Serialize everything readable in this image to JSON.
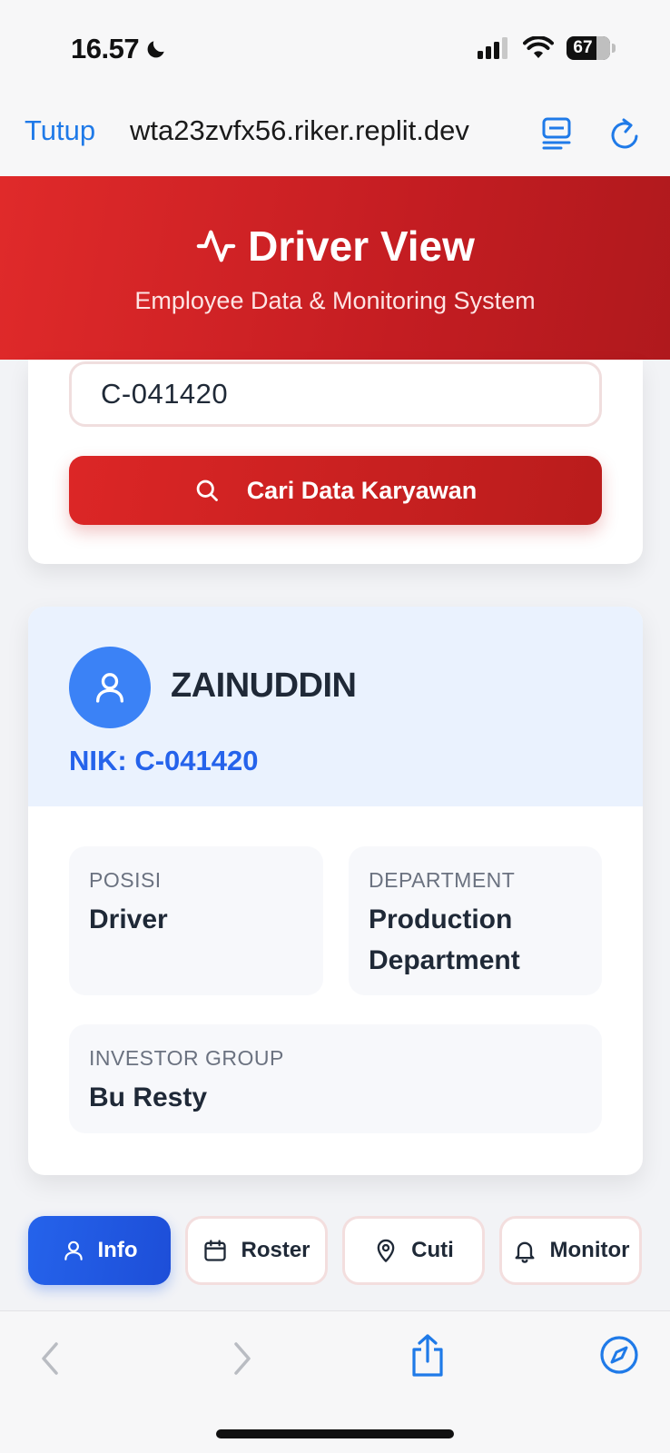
{
  "status_bar": {
    "time": "16.57",
    "battery": "67",
    "icons": [
      "moon-icon",
      "signal-icon",
      "wifi-icon",
      "battery-icon"
    ]
  },
  "browser": {
    "close_label": "Tutup",
    "url": "wta23zvfx56.riker.replit.dev",
    "icons": [
      "reader-icon",
      "reload-icon",
      "back-icon",
      "forward-icon",
      "share-icon",
      "compass-icon"
    ],
    "accent_color": "#1f7ae8"
  },
  "header": {
    "title": "Driver View",
    "subtitle": "Employee Data & Monitoring System",
    "icon": "activity-icon",
    "color": "#d32124"
  },
  "search": {
    "input_value": "C-041420",
    "button_label": "Cari Data Karyawan",
    "button_icon": "search-icon"
  },
  "profile": {
    "name": "ZAINUDDIN",
    "nik": "NIK: C-041420",
    "avatar_icon": "user-icon",
    "fields": {
      "posisi": {
        "label": "POSISI",
        "value": "Driver"
      },
      "department": {
        "label": "DEPARTMENT",
        "value": "Production Department"
      },
      "investor": {
        "label": "INVESTOR GROUP",
        "value": "Bu Resty"
      }
    }
  },
  "tabs": [
    {
      "label": "Info",
      "icon": "user-icon",
      "active": true
    },
    {
      "label": "Roster",
      "icon": "calendar-icon",
      "active": false
    },
    {
      "label": "Cuti",
      "icon": "map-pin-icon",
      "active": false
    },
    {
      "label": "Monitor",
      "icon": "bell-icon",
      "active": false
    }
  ]
}
